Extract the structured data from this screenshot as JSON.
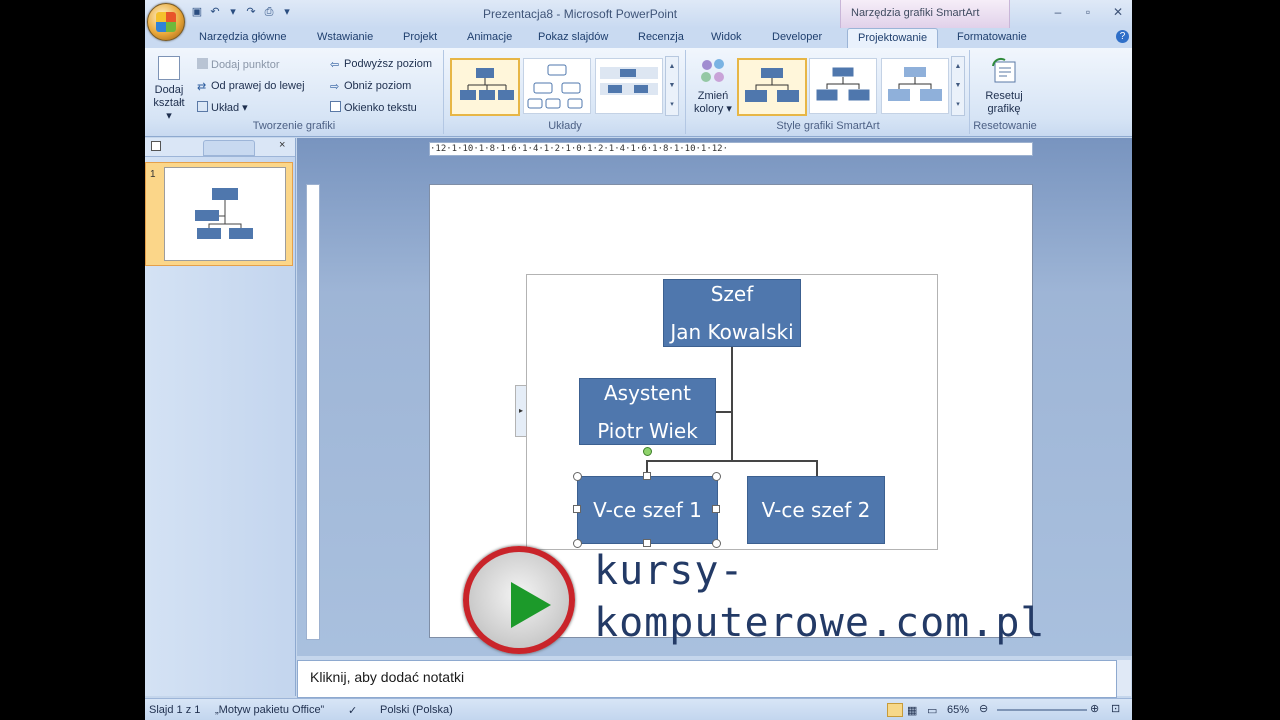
{
  "window": {
    "title": "Prezentacja8 - Microsoft PowerPoint",
    "context_tab_title": "Narzędzia grafiki SmartArt"
  },
  "tabs": [
    {
      "label": "Narzędzia główne"
    },
    {
      "label": "Wstawianie"
    },
    {
      "label": "Projekt"
    },
    {
      "label": "Animacje"
    },
    {
      "label": "Pokaz slajdów"
    },
    {
      "label": "Recenzja"
    },
    {
      "label": "Widok"
    },
    {
      "label": "Developer"
    },
    {
      "label": "Projektowanie",
      "active": true
    },
    {
      "label": "Formatowanie"
    }
  ],
  "ribbon": {
    "create_group": {
      "label": "Tworzenie grafiki",
      "add_shape": "Dodaj kształt",
      "add_bullet": "Dodaj punktor",
      "right_to_left": "Od prawej do lewej",
      "layout": "Układ",
      "promote": "Podwyższ poziom",
      "demote": "Obniż poziom",
      "text_pane": "Okienko tekstu"
    },
    "layouts_group": {
      "label": "Układy"
    },
    "styles_group": {
      "label": "Style grafiki SmartArt",
      "change_colors": "Zmień kolory"
    },
    "reset_group": {
      "label": "Resetowanie",
      "reset": "Resetuj grafikę"
    }
  },
  "slides_panel": {
    "slide_number": "1"
  },
  "ruler": {
    "horizontal": "·12·1·10·1·8·1·6·1·4·1·2·1·0·1·2·1·4·1·6·1·8·1·10·1·12·"
  },
  "slide": {
    "boss": {
      "line1": "Szef",
      "line2": "Jan Kowalski"
    },
    "assistant": {
      "line1": "Asystent",
      "line2": "Piotr Wiek"
    },
    "vp1": "V-ce szef 1",
    "vp2": "V-ce szef 2"
  },
  "notes": {
    "placeholder": "Kliknij, aby dodać notatki"
  },
  "status": {
    "slide": "Slajd 1 z 1",
    "theme": "„Motyw pakietu Office”",
    "language": "Polski (Polska)",
    "zoom": "65%"
  },
  "watermark": {
    "line1": "kursy-",
    "line2": "komputerowe.com.pl"
  },
  "colors": {
    "smartart_box": "#4f77ad",
    "accent_orange": "#fbd689",
    "watermark_red": "#c9242a"
  }
}
